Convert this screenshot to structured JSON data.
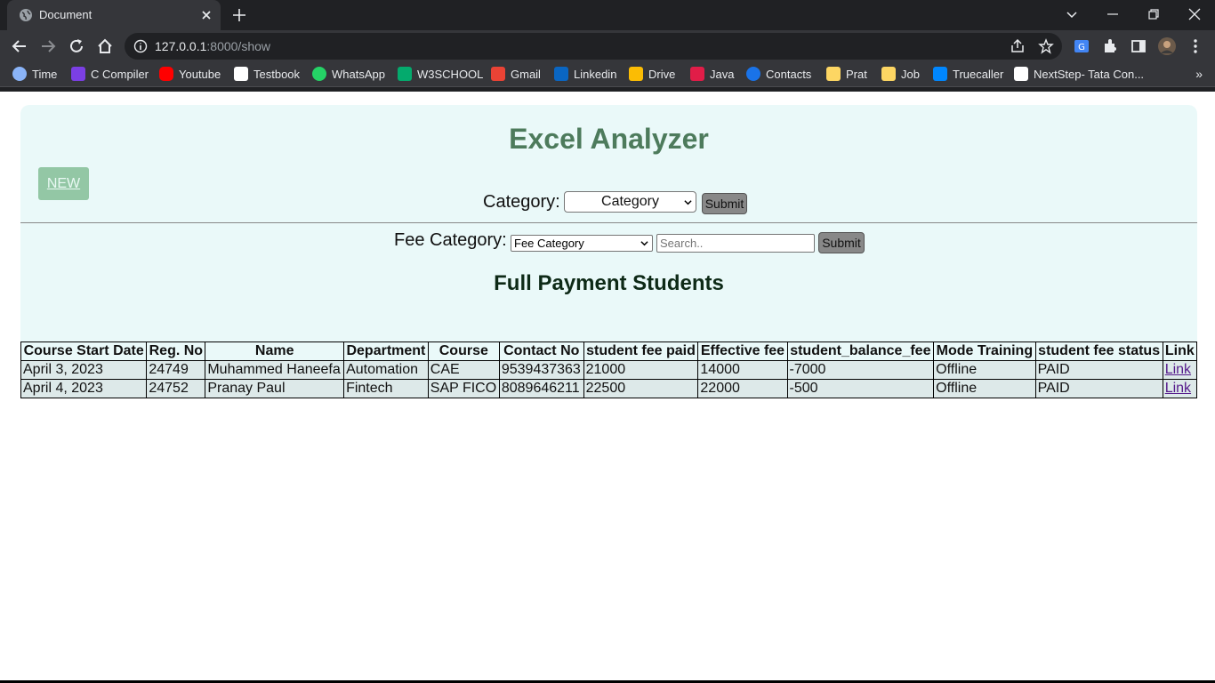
{
  "browser": {
    "tab_title": "Document",
    "url_host": "127.0.0.1",
    "url_rest": ":8000/show",
    "bookmarks": [
      {
        "label": "Time",
        "color": "#8ab4f8"
      },
      {
        "label": "C Compiler",
        "color": "#7b3fe4"
      },
      {
        "label": "Youtube",
        "color": "#ff0000"
      },
      {
        "label": "Testbook",
        "color": "#ffffff"
      },
      {
        "label": "WhatsApp",
        "color": "#25d366"
      },
      {
        "label": "W3SCHOOL",
        "color": "#04aa6d"
      },
      {
        "label": "Gmail",
        "color": "#ea4335"
      },
      {
        "label": "Linkedin",
        "color": "#0a66c2"
      },
      {
        "label": "Drive",
        "color": "#fbbc04"
      },
      {
        "label": "Java",
        "color": "#e11d48"
      },
      {
        "label": "Contacts",
        "color": "#1a73e8"
      },
      {
        "label": "Prat",
        "color": "#fdd663"
      },
      {
        "label": "Job",
        "color": "#fdd663"
      },
      {
        "label": "Truecaller",
        "color": "#0087ff"
      },
      {
        "label": "NextStep- Tata Con...",
        "color": "#ffffff"
      }
    ]
  },
  "page": {
    "title": "Excel Analyzer",
    "new_button": "NEW",
    "category_label": "Category:",
    "category_select": "Category",
    "submit": "Submit",
    "fee_category_label": "Fee Category:",
    "fee_category_select": "Fee Category",
    "search_placeholder": "Search..",
    "section_title": "Full Payment Students"
  },
  "table": {
    "headers": [
      "Course Start Date",
      "Reg. No",
      "Name",
      "Department",
      "Course",
      "Contact No",
      "student fee paid",
      "Effective fee",
      "student_balance_fee",
      "Mode Training",
      "student fee status",
      "Link"
    ],
    "rows": [
      [
        "April 3, 2023",
        "24749",
        "Muhammed Haneefa",
        "Automation",
        "CAE",
        "9539437363",
        "21000",
        "14000",
        "-7000",
        "Offline",
        "PAID",
        "Link"
      ],
      [
        "April 4, 2023",
        "24752",
        "Pranay Paul",
        "Fintech",
        "SAP FICO",
        "8089646211",
        "22500",
        "22000",
        "-500",
        "Offline",
        "PAID",
        "Link"
      ]
    ]
  }
}
